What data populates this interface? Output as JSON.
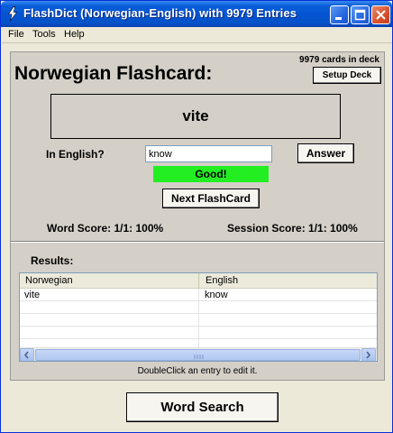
{
  "window": {
    "title": "FlashDict (Norwegian-English) with 9979 Entries"
  },
  "menu": [
    "File",
    "Tools",
    "Help"
  ],
  "panel": {
    "cards_in_deck": "9979 cards in deck",
    "heading": "Norwegian Flashcard:",
    "setup_deck_label": "Setup Deck",
    "current_word": "vite",
    "prompt_label": "In English?",
    "answer_value": "know",
    "answer_button_label": "Answer",
    "feedback": "Good!",
    "next_button_label": "Next FlashCard",
    "word_score": "Word Score: 1/1: 100%",
    "session_score": "Session Score: 1/1: 100%"
  },
  "results": {
    "label": "Results:",
    "columns": [
      "Norwegian",
      "English"
    ],
    "rows": [
      {
        "norwegian": "vite",
        "english": "know"
      }
    ],
    "hint": "DoubleClick an entry to edit it."
  },
  "word_search_label": "Word Search",
  "colors": {
    "titlebar": "#0554d2",
    "feedback_green": "#22ee22",
    "panel_bg": "#d4d0c8"
  }
}
